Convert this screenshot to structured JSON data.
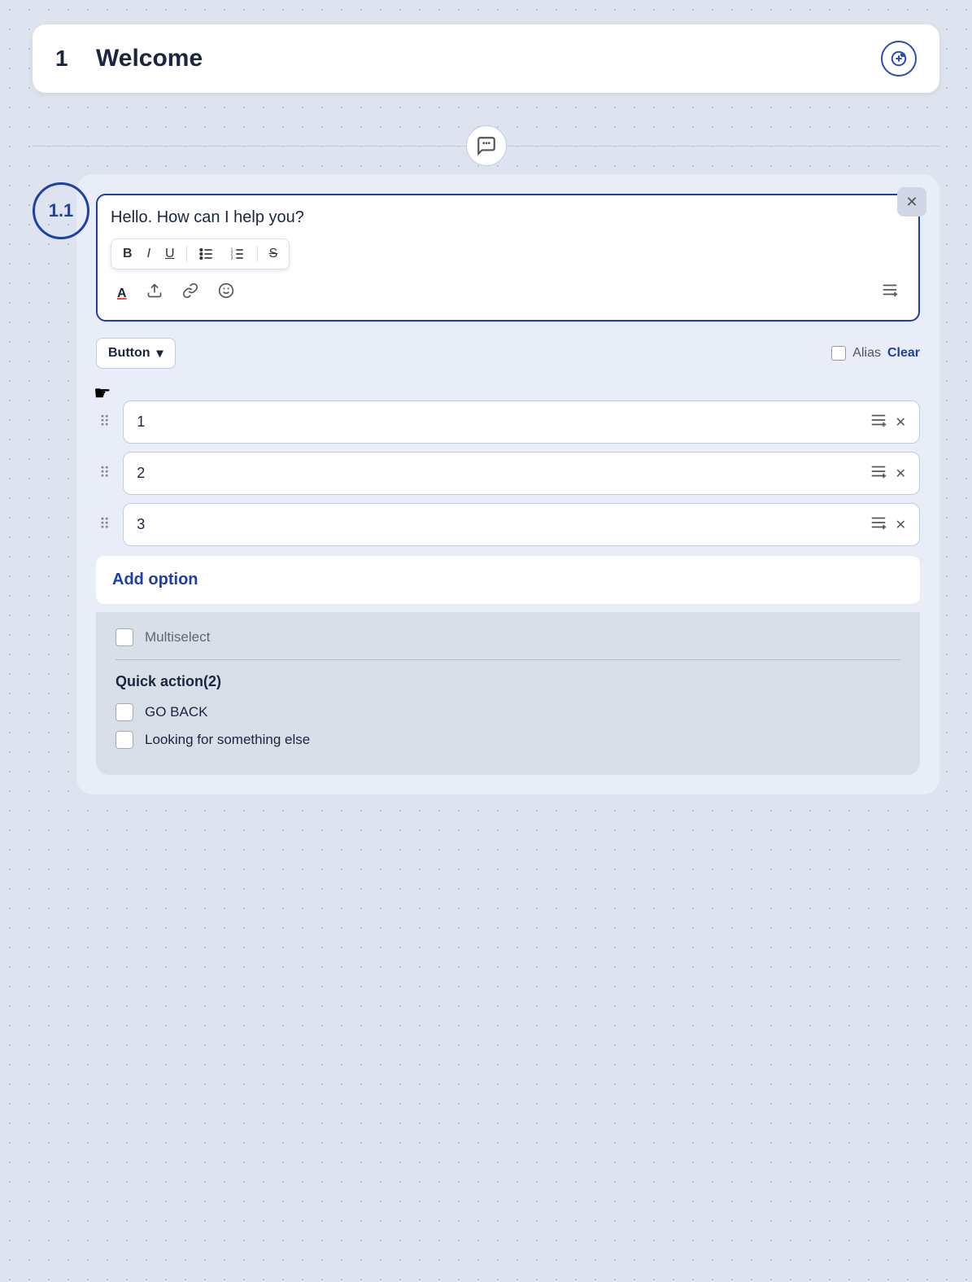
{
  "welcome": {
    "number": "1",
    "title": "Welcome",
    "icon_label": "⊕"
  },
  "chat_icon": "💬",
  "step_badge": "1.1",
  "close_icon": "✕",
  "editor": {
    "text": "Hello. How can I help you?",
    "toolbar": {
      "bold": "B",
      "italic": "I",
      "underline": "U",
      "bullet_list": "☰",
      "numbered_list": "☰",
      "strikethrough": "S",
      "text_color": "A",
      "upload": "↑",
      "link": "🔗",
      "emoji": "☺",
      "add_format": "≡+"
    }
  },
  "button_row": {
    "dropdown_label": "Button",
    "dropdown_arrow": "▾",
    "alias_label": "Alias",
    "clear_label": "Clear"
  },
  "options": [
    {
      "id": 1,
      "value": "1"
    },
    {
      "id": 2,
      "value": "2"
    },
    {
      "id": 3,
      "value": "3"
    }
  ],
  "add_option_label": "Add option",
  "multiselect_label": "Multiselect",
  "quick_action": {
    "title": "Quick action(2)",
    "items": [
      {
        "label": "GO BACK"
      },
      {
        "label": "Looking for something else"
      }
    ]
  }
}
